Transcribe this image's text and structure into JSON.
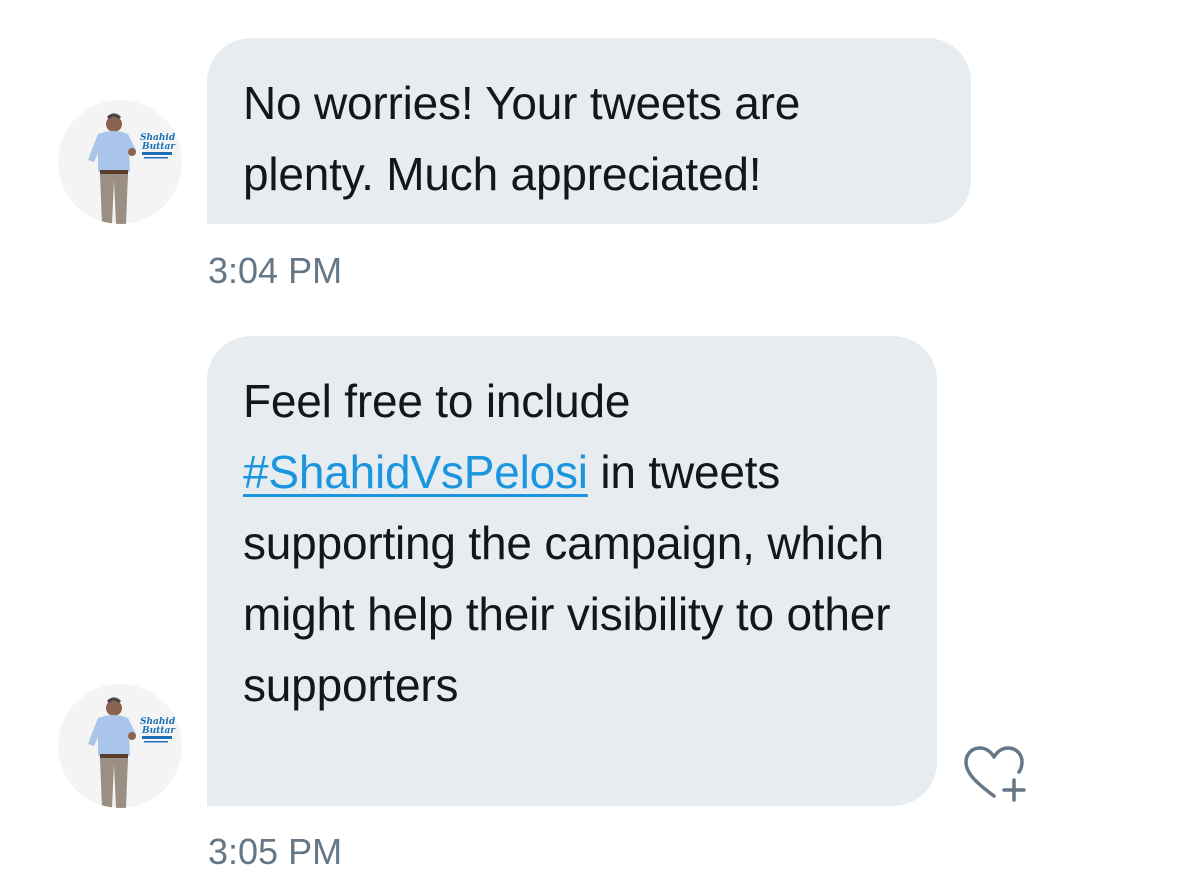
{
  "messages": [
    {
      "text": "No worries! Your tweets are plenty. Much appreciated!",
      "timestamp": "3:04 PM"
    },
    {
      "text_before": "Feel free to include ",
      "hashtag": "#ShahidVsPelosi",
      "text_after": " in tweets supporting the campaign, which might help their visibility to other supporters",
      "timestamp": "3:05 PM"
    }
  ],
  "avatar": {
    "logo_line1": "Shahid",
    "logo_line2": "Buttar"
  },
  "icons": {
    "like": "heart-plus-icon"
  },
  "colors": {
    "bubble": "#e6ecf0",
    "text": "#14171a",
    "hashtag": "#1b95e0",
    "timestamp": "#657786",
    "icon": "#657786"
  }
}
